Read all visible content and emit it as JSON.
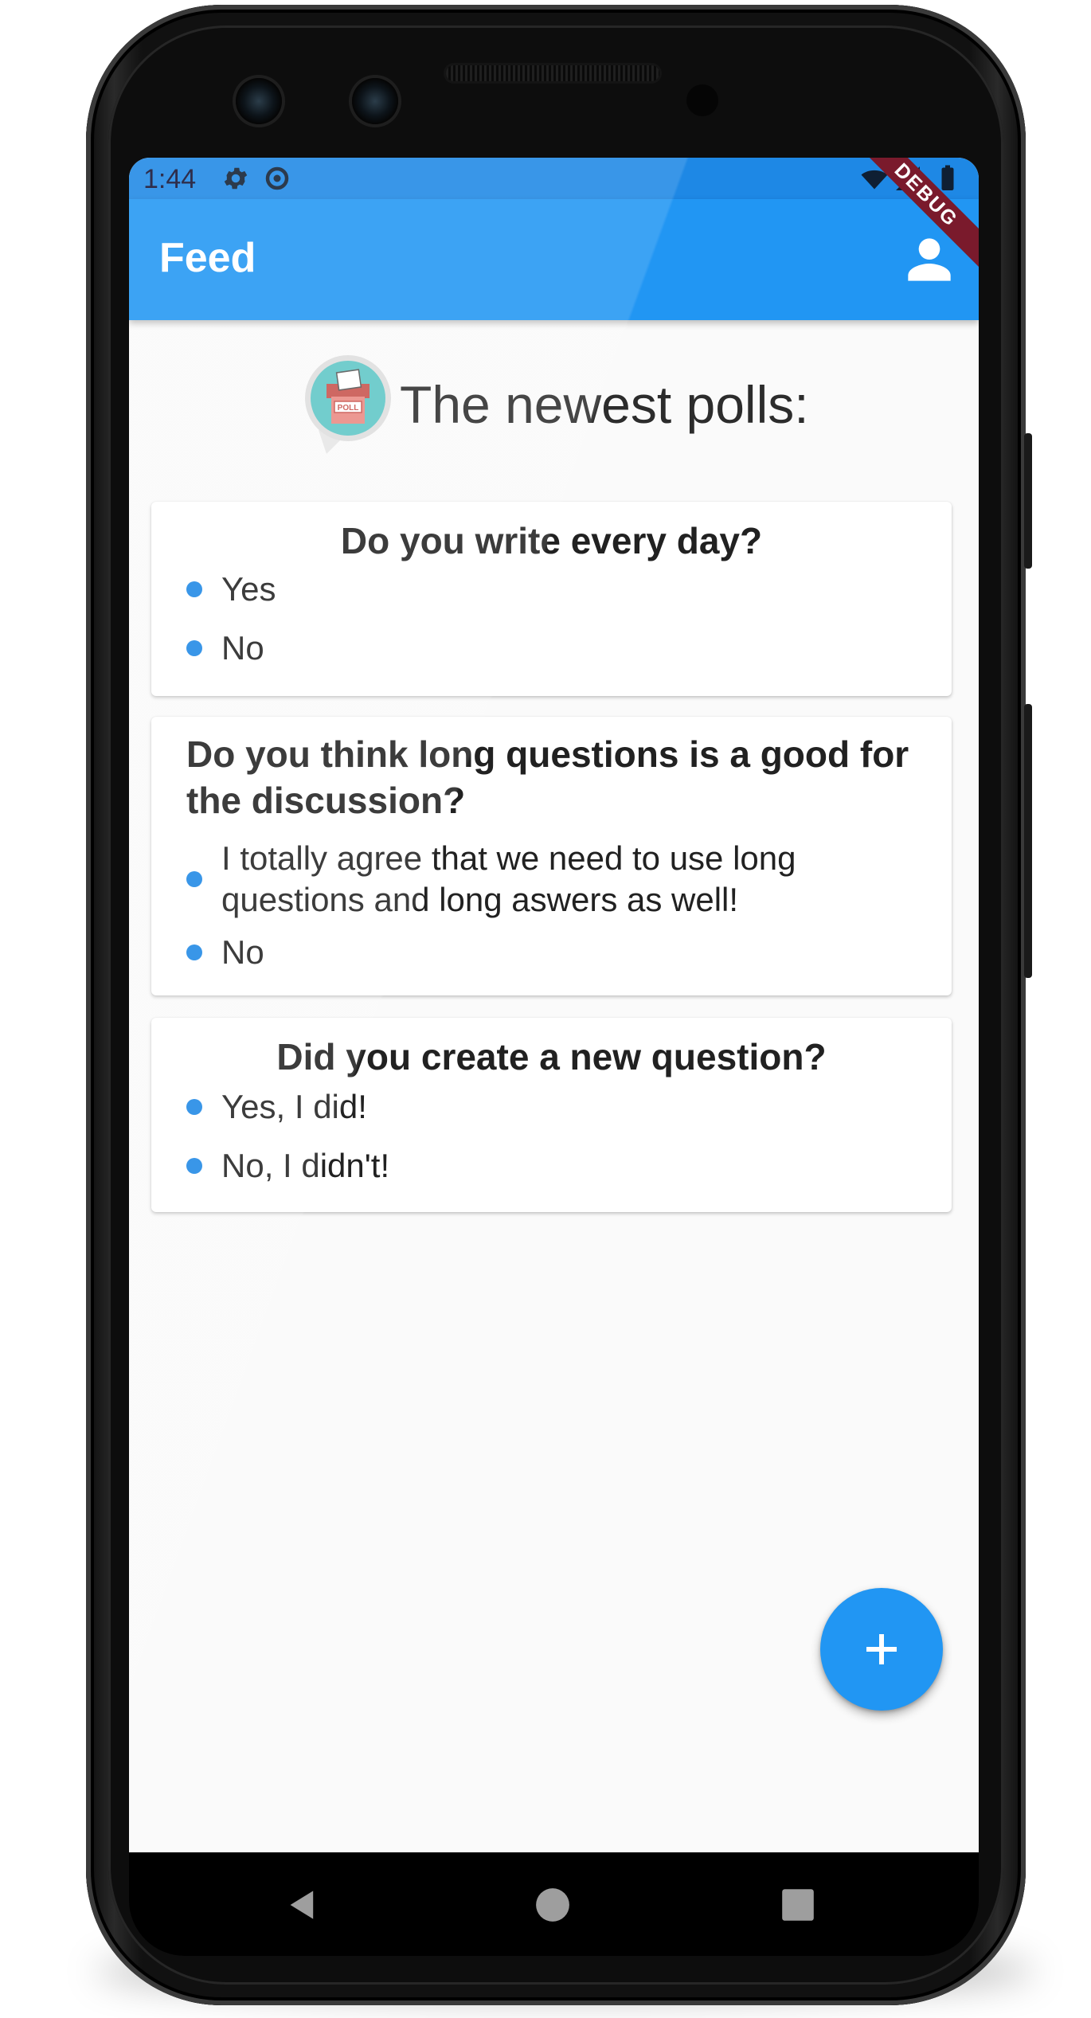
{
  "status_bar": {
    "time": "1:44",
    "icons": [
      "settings-icon",
      "sync-icon",
      "wifi-icon",
      "signal-icon",
      "battery-icon"
    ]
  },
  "debug_banner": "DEBUG",
  "app_bar": {
    "title": "Feed",
    "action_icon": "person-icon"
  },
  "header": {
    "logo_text": "POLL",
    "title": "The newest polls:"
  },
  "polls": [
    {
      "question": "Do you write every day?",
      "options": [
        "Yes",
        "No"
      ]
    },
    {
      "question": "Do you think long questions is a good for the discussion?",
      "options": [
        "I totally agree that we need to use long questions and long aswers as well!",
        "No"
      ]
    },
    {
      "question": "Did you create a new question?",
      "options": [
        "Yes, I did!",
        "No, I didn't!"
      ]
    }
  ],
  "fab": {
    "icon": "plus-icon"
  },
  "nav": {
    "icons": [
      "back-icon",
      "home-icon",
      "recents-icon"
    ]
  },
  "colors": {
    "primary": "#2196f3",
    "status_bar": "#1e88e5",
    "accent_dot": "#1e88e5",
    "debug": "#7a1a2c"
  }
}
